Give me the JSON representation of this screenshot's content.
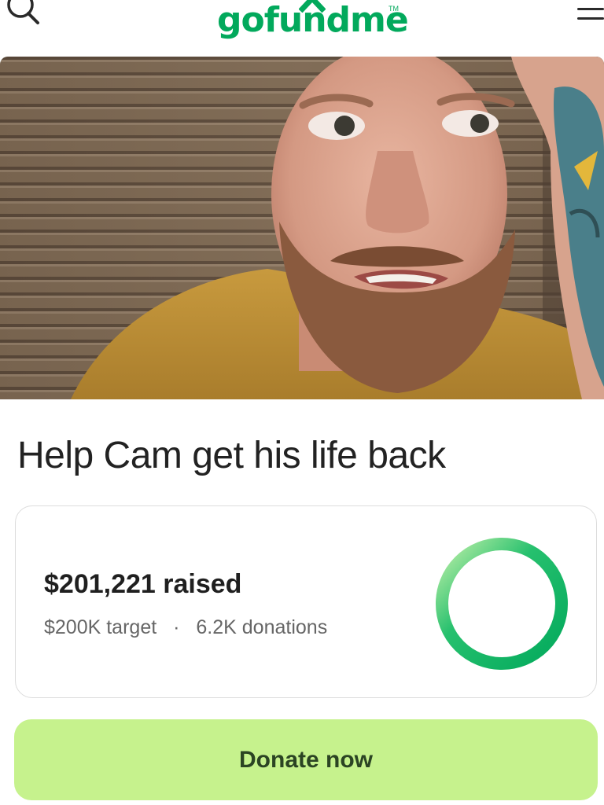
{
  "header": {
    "logo_text": "gofundme",
    "logo_tm": "TM",
    "search_icon": "search-icon",
    "menu_icon": "hamburger-menu-icon"
  },
  "campaign": {
    "image_alt": "Photo of a bearded man in a mustard shirt in front of window blinds",
    "title": "Help Cam get his life back"
  },
  "progress": {
    "raised_amount": "$201,221",
    "raised_label": "raised",
    "target": "$200K target",
    "separator": "·",
    "donations": "6.2K donations",
    "percent_complete": 100,
    "colors": {
      "ring_dark": "#02a95c",
      "ring_light": "#c7f0b0"
    }
  },
  "cta": {
    "donate_label": "Donate now",
    "color": "#c6f28d"
  },
  "colors": {
    "brand": "#02a95c"
  }
}
